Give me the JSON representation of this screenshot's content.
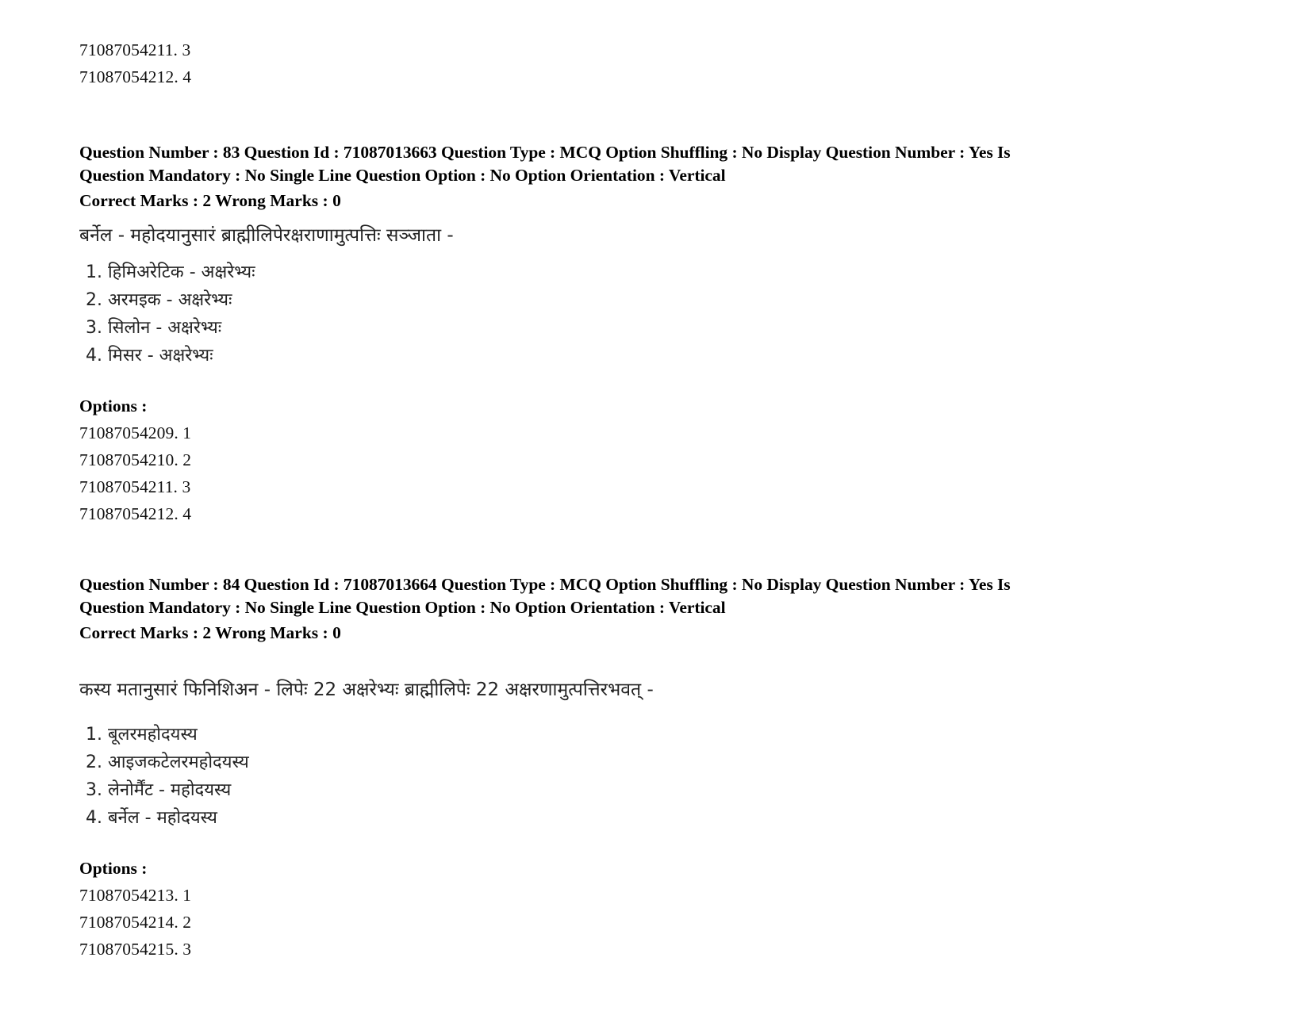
{
  "document": {
    "type": "exam-question-paper",
    "language": "Sanskrit / Devanagari with English metadata"
  },
  "top_option_ids": [
    "71087054211. 3",
    "71087054212. 4"
  ],
  "questions": [
    {
      "meta_line1": "Question Number : 83 Question Id : 71087013663 Question Type : MCQ Option Shuffling : No Display Question Number : Yes Is",
      "meta_line2": "Question Mandatory : No Single Line Question Option : No Option Orientation : Vertical",
      "marks_line": "Correct Marks : 2 Wrong Marks : 0",
      "question_number": "83",
      "question_id": "71087013663",
      "question_type": "MCQ",
      "option_shuffling": "No",
      "display_question_number": "Yes",
      "is_question_mandatory": "No",
      "single_line_question_option": "No",
      "option_orientation": "Vertical",
      "correct_marks": "2",
      "wrong_marks": "0",
      "stem": "बर्नेल - महोदयानुसारं ब्राह्मीलिपेरक्षराणामुत्पत्तिः सञ्जाता -",
      "choices": [
        "1. हिमिअरेटिक - अक्षरेभ्यः",
        "2. अरमइक - अक्षरेभ्यः",
        "3. सिलोन - अक्षरेभ्यः",
        "4. मिसर - अक्षरेभ्यः"
      ],
      "options_label": "Options :",
      "option_ids": [
        "71087054209. 1",
        "71087054210. 2",
        "71087054211. 3",
        "71087054212. 4"
      ]
    },
    {
      "meta_line1": "Question Number : 84 Question Id : 71087013664 Question Type : MCQ Option Shuffling : No Display Question Number : Yes Is",
      "meta_line2": "Question Mandatory : No Single Line Question Option : No Option Orientation : Vertical",
      "marks_line": "Correct Marks : 2 Wrong Marks : 0",
      "question_number": "84",
      "question_id": "71087013664",
      "question_type": "MCQ",
      "option_shuffling": "No",
      "display_question_number": "Yes",
      "is_question_mandatory": "No",
      "single_line_question_option": "No",
      "option_orientation": "Vertical",
      "correct_marks": "2",
      "wrong_marks": "0",
      "stem": "कस्य मतानुसारं फिनिशिअन - लिपेः 22 अक्षरेभ्यः ब्राह्मीलिपेः 22 अक्षरणामुत्पत्तिरभवत् -",
      "choices": [
        "1. बूलरमहोदयस्य",
        "2. आइजकटेलरमहोदयस्य",
        "3. लेनोर्मैंट - महोदयस्य",
        "4. बर्नेल - महोदयस्य"
      ],
      "options_label": "Options :",
      "option_ids": [
        "71087054213. 1",
        "71087054214. 2",
        "71087054215. 3"
      ]
    }
  ]
}
